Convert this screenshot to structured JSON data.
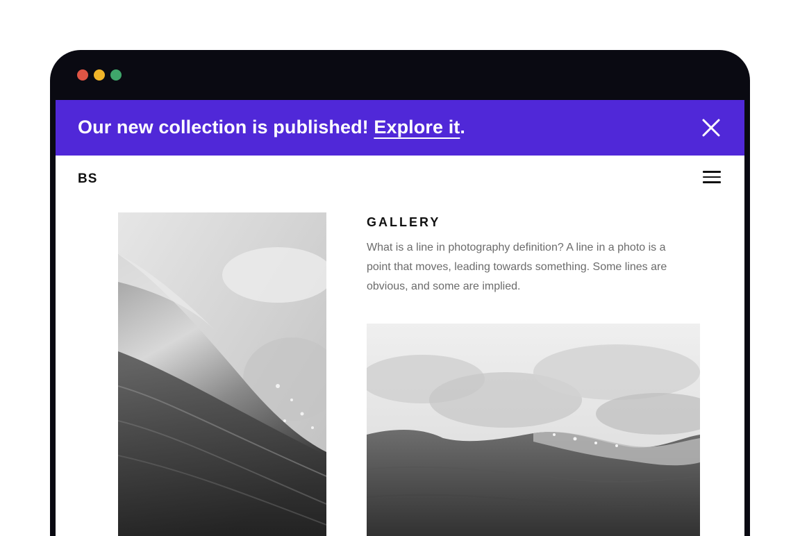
{
  "colors": {
    "frame": "#0a0a12",
    "banner": "#5028d8",
    "dot_red": "#e05545",
    "dot_yellow": "#f0b429",
    "dot_green": "#3fa66b"
  },
  "window": {
    "controls": [
      "close",
      "minimize",
      "maximize"
    ]
  },
  "banner": {
    "message": "Our new collection is published!",
    "link_text": "Explore it",
    "suffix": ".",
    "close_icon": "close-icon"
  },
  "navbar": {
    "brand": "BS",
    "menu_icon": "hamburger-menu-icon"
  },
  "gallery": {
    "title": "GALLERY",
    "description": "What is a line in photography definition? A line in a photo is a point that moves, leading towards something. Some lines are obvious, and some are implied.",
    "images": [
      "wave-photo-vertical",
      "wave-photo-horizontal"
    ]
  }
}
